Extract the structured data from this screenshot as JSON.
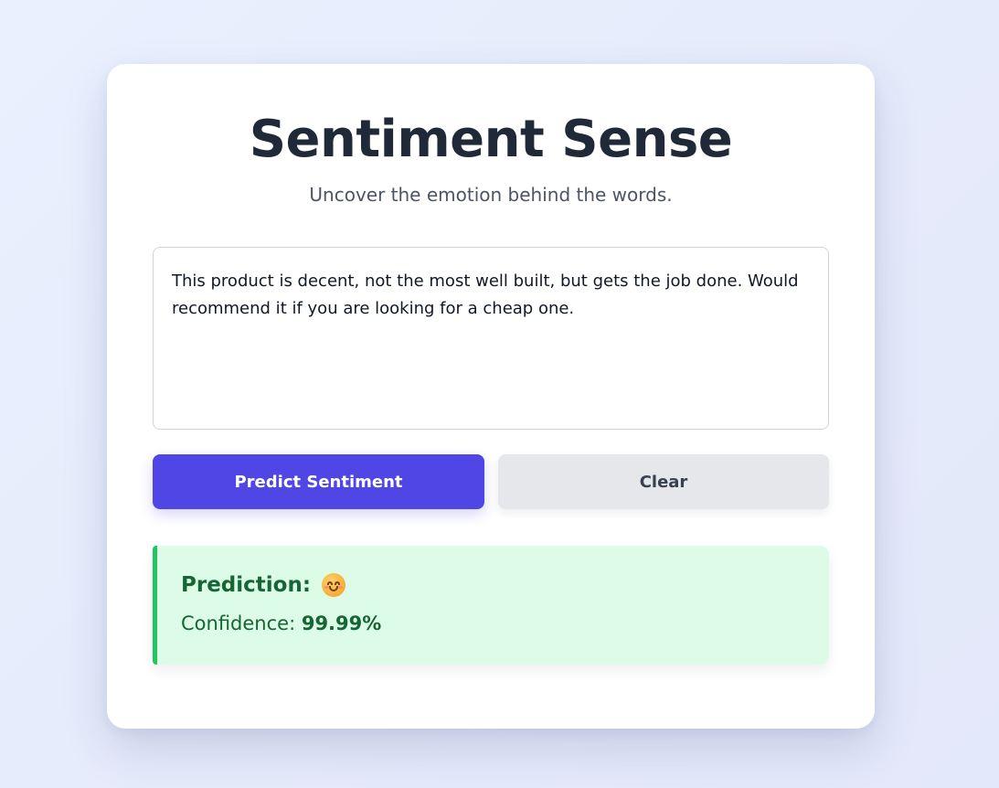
{
  "app": {
    "title": "Sentiment Sense",
    "subtitle": "Uncover the emotion behind the words."
  },
  "input": {
    "value": "This product is decent, not the most well built, but gets the job done. Would recommend it if you are looking for a cheap one."
  },
  "buttons": {
    "predict_label": "Predict Sentiment",
    "clear_label": "Clear"
  },
  "result": {
    "prediction_label": "Prediction:",
    "prediction_icon": "smiling-face-emoji",
    "confidence_label": "Confidence:",
    "confidence_value": "99.99%"
  },
  "colors": {
    "accent": "#4f46e5",
    "result_background": "#dcfce7",
    "result_border": "#22c55e",
    "result_text": "#166534"
  }
}
